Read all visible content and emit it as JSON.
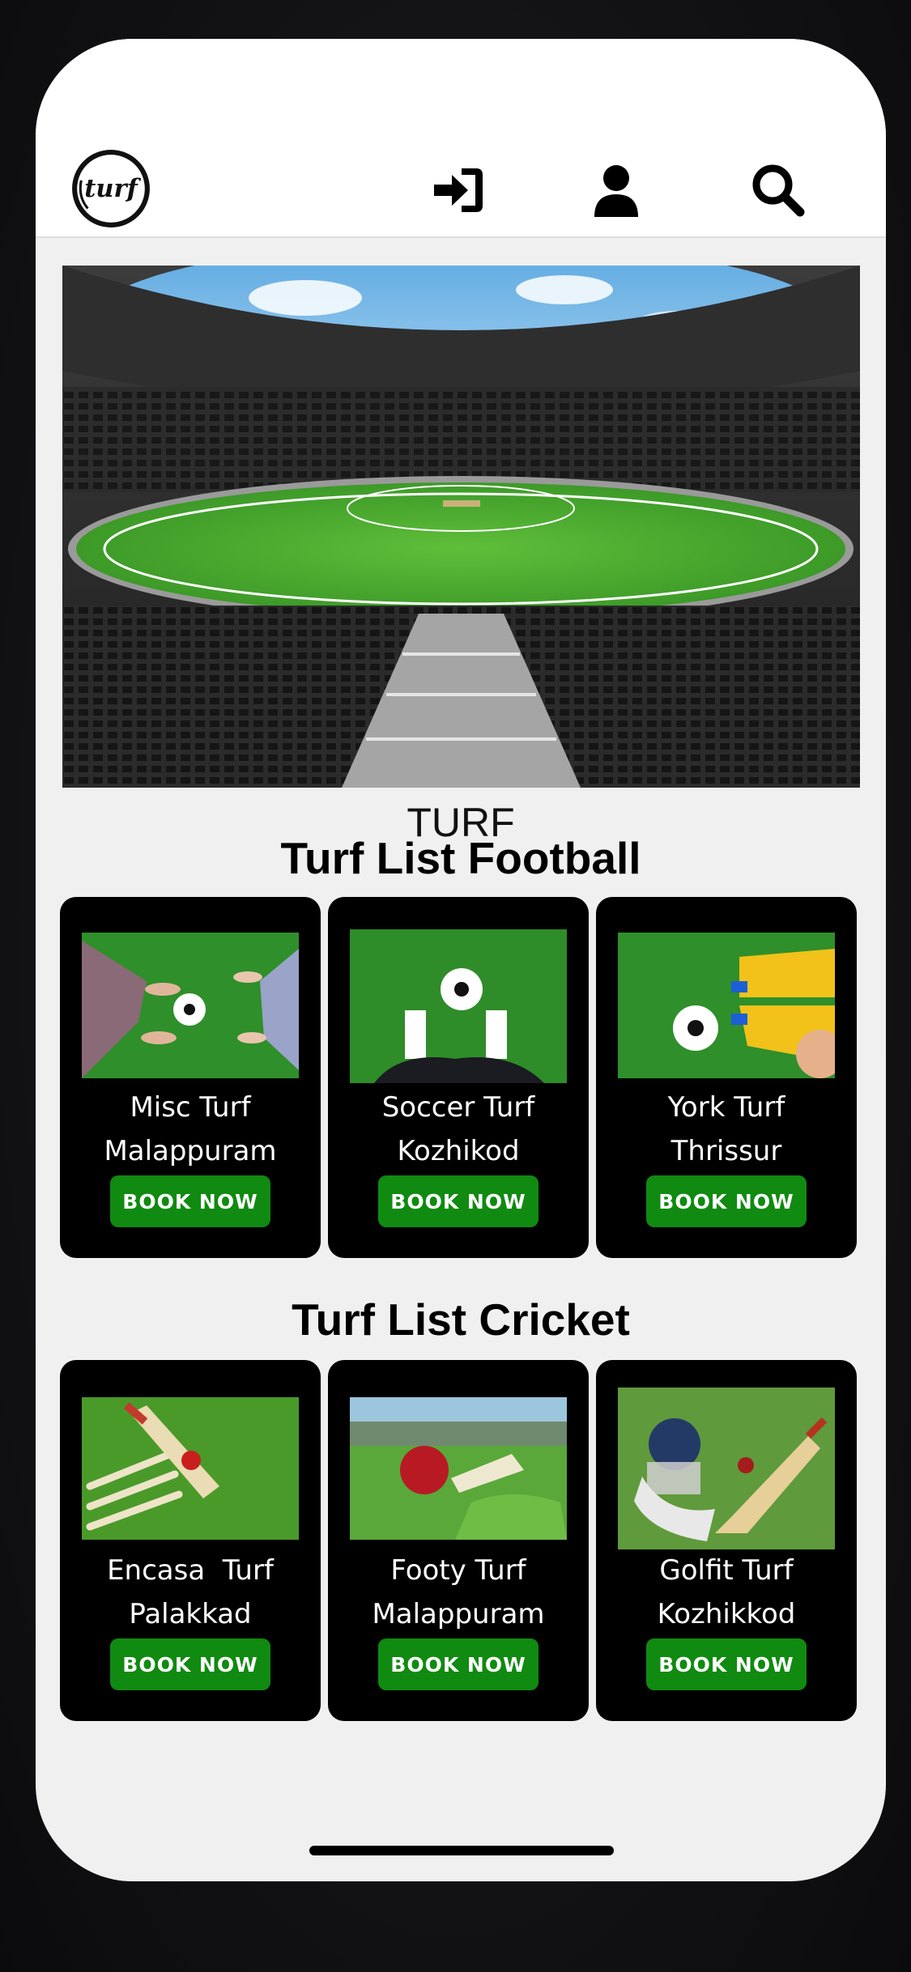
{
  "header": {
    "logo_text": "turf",
    "icons": [
      "sign-in-icon",
      "user-icon",
      "search-icon"
    ]
  },
  "site_name": "TURF",
  "football": {
    "title": "Turf List Football",
    "cards": [
      {
        "name": "Misc Turf",
        "city": "Malappuram",
        "button": "BOOK NOW"
      },
      {
        "name": "Soccer Turf",
        "city": "Kozhikod",
        "button": "BOOK NOW"
      },
      {
        "name": "York Turf",
        "city": "Thrissur",
        "button": "BOOK NOW"
      }
    ]
  },
  "cricket": {
    "title": "Turf List Cricket",
    "cards": [
      {
        "name": "Encasa  Turf",
        "city": "Palakkad",
        "button": "BOOK NOW"
      },
      {
        "name": "Footy Turf",
        "city": "Malappuram",
        "button": "BOOK NOW"
      },
      {
        "name": "Golfit Turf",
        "city": "Kozhikkod",
        "button": "BOOK NOW"
      }
    ]
  },
  "colors": {
    "accent_green": "#108a10",
    "card_bg": "#000000",
    "page_bg": "#f0f0f0"
  }
}
